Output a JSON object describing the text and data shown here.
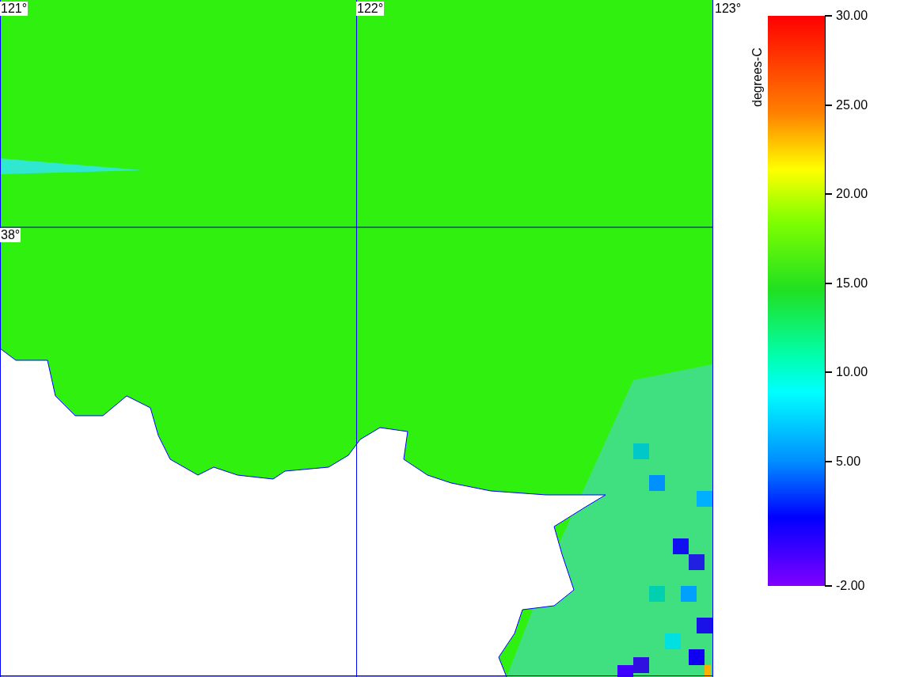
{
  "map": {
    "lon_labels": [
      "121°",
      "122°",
      "123°"
    ],
    "lat_labels": [
      "38°"
    ]
  },
  "legend": {
    "unit": "degrees-C",
    "ticks": [
      "30.00",
      "25.00",
      "20.00",
      "15.00",
      "10.00",
      "5.00",
      "-2.00"
    ]
  }
}
